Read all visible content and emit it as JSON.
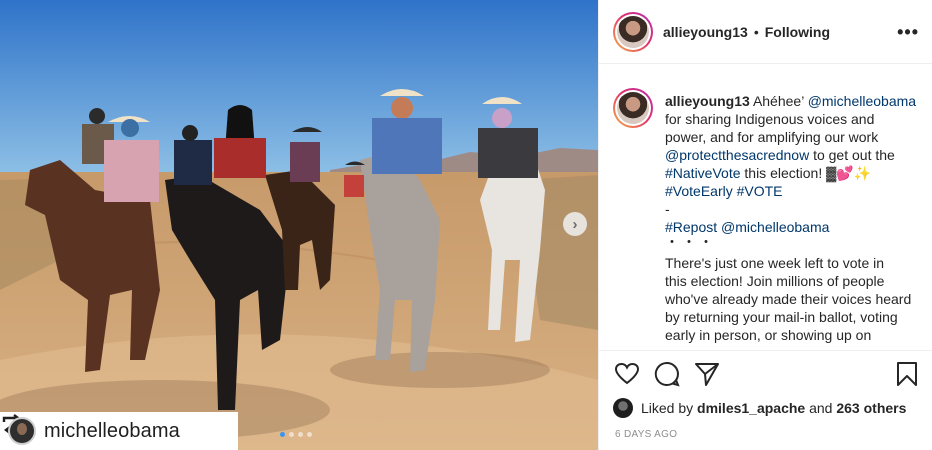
{
  "post": {
    "username": "allieyoung13",
    "separator": "•",
    "follow_status": "Following",
    "more_icon": "more-horizontal-icon"
  },
  "caption": {
    "username": "allieyoung13",
    "greeting": "Ahéhee’",
    "mention_1": "@michelleobama",
    "line_1b": "for sharing Indigenous voices and",
    "line_2": "power, and for amplifying our work",
    "mention_2": "@protectthesacrednow",
    "line_3b": "to get out the",
    "hashtag_1": "#NativeVote",
    "line_4b": "this election! ▓💕✨",
    "hashtag_2": "#VoteEarly",
    "hashtag_3": "#VOTE",
    "dash": "-",
    "hashtag_4": "#Repost",
    "mention_3": "@michelleobama",
    "ellipsis": "・・・",
    "body_1": "There's just one week left to vote in",
    "body_2": "this election! Join millions of people",
    "body_3": "who've already made their voices heard",
    "body_4": "by returning your mail-in ballot, voting",
    "body_5": "early in person, or showing up on"
  },
  "actions": {
    "like_icon": "heart-icon",
    "comment_icon": "comment-icon",
    "share_icon": "share-icon",
    "save_icon": "bookmark-icon"
  },
  "likes": {
    "prefix": "Liked by",
    "liker": "dmiles1_apache",
    "conjunction": "and",
    "others": "263 others"
  },
  "timestamp": "6 DAYS AGO",
  "photo": {
    "repost_username": "michelleobama",
    "carousel_count": 4,
    "carousel_active": 0,
    "next_icon": "chevron-right-icon",
    "repost_icon": "repost-icon"
  },
  "colors": {
    "link": "#00376b",
    "muted": "#8e8e8e",
    "carousel_active": "#3b95ed",
    "story_ring_start": "#f7b346",
    "story_ring_end": "#b42fb0"
  }
}
